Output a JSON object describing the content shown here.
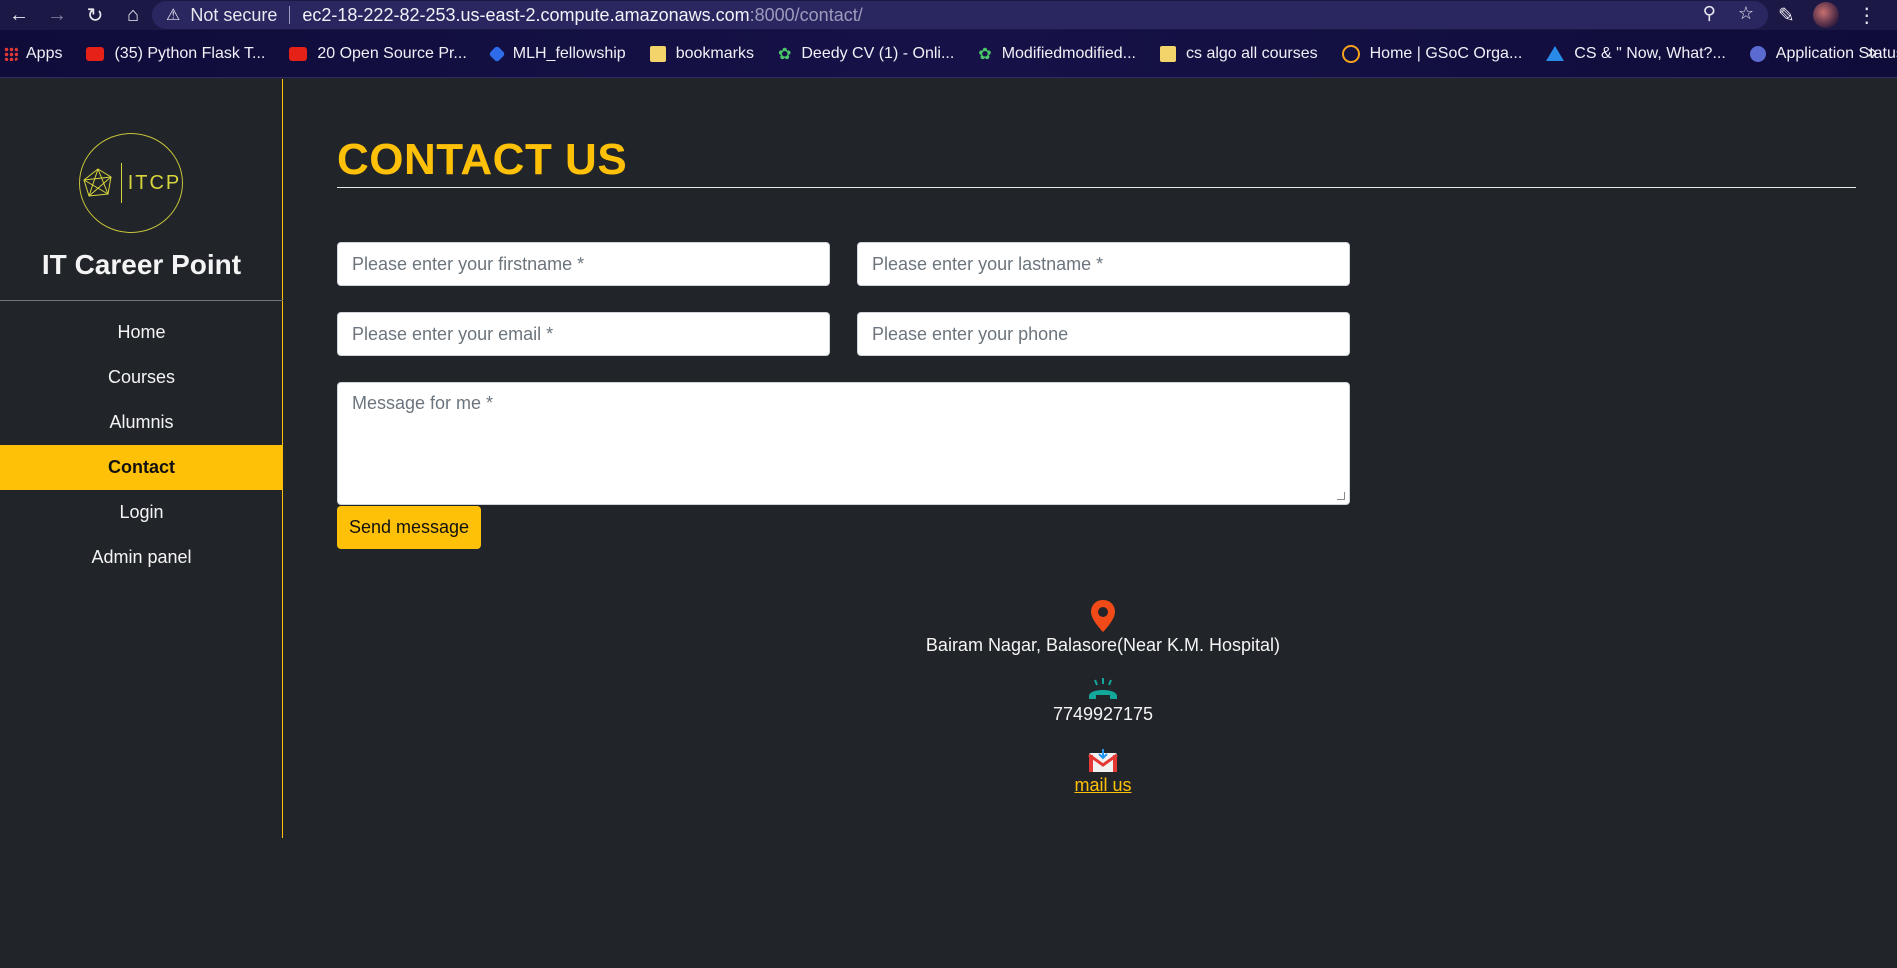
{
  "browser": {
    "security_label": "Not secure",
    "url_host": "ec2-18-222-82-253.us-east-2.compute.amazonaws.com",
    "url_path": ":8000/contact/",
    "bookmarks": [
      {
        "label": "Apps",
        "icon": "apps-grid-icon"
      },
      {
        "label": "(35) Python Flask T...",
        "icon": "youtube-icon"
      },
      {
        "label": "20 Open Source Pr...",
        "icon": "youtube-icon"
      },
      {
        "label": "MLH_fellowship",
        "icon": "mlh-icon"
      },
      {
        "label": "bookmarks",
        "icon": "folder-icon"
      },
      {
        "label": "Deedy CV (1) - Onli...",
        "icon": "overleaf-icon"
      },
      {
        "label": "Modifiedmodified...",
        "icon": "overleaf-icon"
      },
      {
        "label": "cs algo all courses",
        "icon": "folder-icon"
      },
      {
        "label": "Home | GSoC Orga...",
        "icon": "gsoc-icon"
      },
      {
        "label": "CS & \" Now, What?...",
        "icon": "drive-icon"
      },
      {
        "label": "Application Status",
        "icon": "app-status-icon"
      }
    ],
    "more_label": "»"
  },
  "sidebar": {
    "logo_text": "ITCP",
    "brand": "IT Career Point",
    "menu": [
      "Home",
      "Courses",
      "Alumnis",
      "Contact",
      "Login",
      "Admin panel"
    ],
    "active_index": 3
  },
  "main": {
    "title": "CONTACT US",
    "form": {
      "firstname_placeholder": "Please enter your firstname *",
      "lastname_placeholder": "Please enter your lastname *",
      "email_placeholder": "Please enter your email *",
      "phone_placeholder": "Please enter your phone",
      "message_placeholder": "Message for me *",
      "submit_label": "Send message"
    },
    "contact": {
      "address": "Bairam Nagar, Balasore(Near K.M. Hospital)",
      "phone": "7749927175",
      "mail_label": "mail us"
    }
  },
  "colors": {
    "accent": "#ffc107",
    "page_bg": "#212529"
  }
}
